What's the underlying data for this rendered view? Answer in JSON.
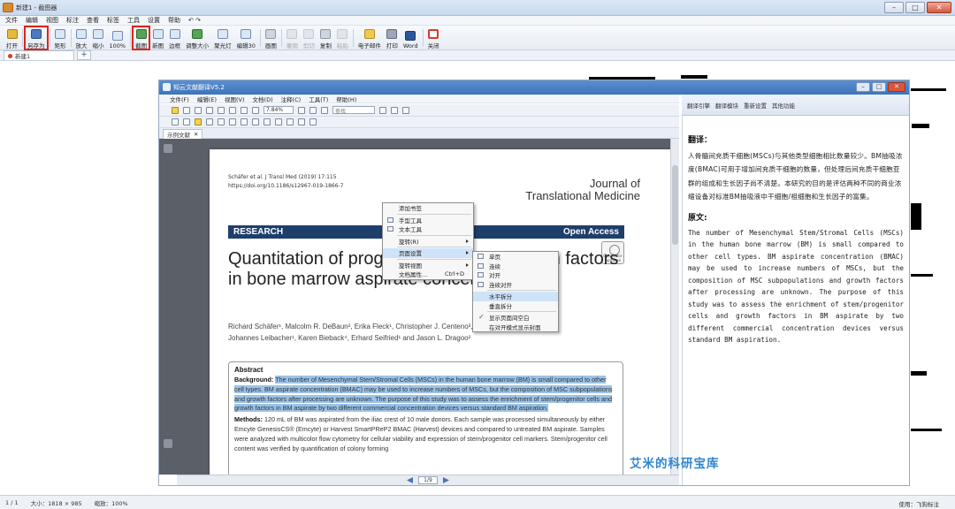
{
  "window": {
    "title": "新建1 - 截图器"
  },
  "menu": [
    "文件",
    "编辑",
    "视图",
    "标注",
    "查看",
    "标签",
    "工具",
    "设置",
    "帮助",
    "↶ ↷"
  ],
  "toolbar": [
    {
      "label": "打开",
      "icon": "open-folder-icon",
      "state": "normal"
    },
    {
      "label": "另存为",
      "icon": "save-as-icon",
      "state": "highlighted"
    },
    {
      "label": "矩形",
      "icon": "rect-select-icon",
      "state": "normal"
    },
    {
      "label": "放大",
      "icon": "zoom-in-icon",
      "state": "normal"
    },
    {
      "label": "缩小",
      "icon": "zoom-out-icon",
      "state": "normal"
    },
    {
      "label": "100%",
      "icon": "zoom-100-icon",
      "state": "normal"
    },
    {
      "label": "截图",
      "icon": "screenshot-icon",
      "state": "highlighted"
    },
    {
      "label": "新图",
      "icon": "new-image-icon",
      "state": "normal"
    },
    {
      "label": "边框",
      "icon": "border-icon",
      "state": "normal"
    },
    {
      "label": "调整大小",
      "icon": "resize-icon",
      "state": "normal"
    },
    {
      "label": "聚光灯",
      "icon": "spotlight-icon",
      "state": "normal"
    },
    {
      "label": "编辑30",
      "icon": "edit-icon",
      "state": "normal"
    },
    {
      "label": "画图",
      "icon": "paint-icon",
      "state": "normal"
    },
    {
      "label": "撤销",
      "icon": "undo-icon",
      "state": "disabled"
    },
    {
      "label": "剪切",
      "icon": "cut-icon",
      "state": "disabled"
    },
    {
      "label": "复制",
      "icon": "copy-icon",
      "state": "normal"
    },
    {
      "label": "粘贴",
      "icon": "paste-icon",
      "state": "disabled"
    },
    {
      "label": "电子邮件",
      "icon": "email-icon",
      "state": "normal"
    },
    {
      "label": "打印",
      "icon": "print-icon",
      "state": "normal"
    },
    {
      "label": "Word",
      "icon": "word-icon",
      "state": "normal"
    },
    {
      "label": "关闭",
      "icon": "close-circle-icon",
      "state": "normal"
    }
  ],
  "tabs": [
    {
      "label": "新建1"
    }
  ],
  "status": {
    "page": "1 / 1",
    "size": "大小：1818 × 985",
    "zoom": "缩放：100%",
    "right": "使用：飞狗标注"
  },
  "inner": {
    "title": "知云文献翻译V5.2",
    "menu": [
      "文件(F)",
      "编辑(E)",
      "视图(V)",
      "文档(D)",
      "注释(C)",
      "工具(T)",
      "帮助(H)"
    ],
    "zoom": "7.84%",
    "search_placeholder": "查找",
    "doc_tab": "示例文献",
    "page_nav": "1/9",
    "panel_tabs": [
      "翻译引擎",
      "翻译模块",
      "重新设置",
      "其他功能"
    ],
    "paper": {
      "citation": "Schäfer et al. J Transl Med        (2019) 17:115",
      "doi": "https://doi.org/10.1186/s12967-019-1866-7",
      "journal_line1": "Journal of",
      "journal_line2": "Translational Medicine",
      "section": "RESEARCH",
      "open_access": "Open Access",
      "check_updates": "Check for updates",
      "title": "Quantitation of progenitor cells and growth factors in bone marrow aspirate concentration",
      "authors_line1": "Richard Schäfer¹, Malcolm R. DeBaun², Erika Fleck¹, Christopher J. Centeno³, Daniel Kraft⁴,",
      "authors_line2": "Johannes Leibacher¹, Karen Bieback⁴, Erhard Seifried¹ and Jason L. Dragoo²",
      "abstract_heading": "Abstract",
      "background_label": "Background:",
      "background_text": "The number of Mesenchymal Stem/Stromal Cells (MSCs) in the human bone marrow (BM) is small compared to other cell types. BM aspirate concentration (BMAC) may be used to increase numbers of MSCs, but the composition of MSC subpopulations and growth factors after processing are unknown. The purpose of this study was to assess the enrichment of stem/progenitor cells and growth factors in BM aspirate by two different commercial concentration devices versus standard BM aspiration.",
      "methods_label": "Methods:",
      "methods_text": "120 mL of BM was aspirated from the iliac crest of 10 male donors. Each sample was processed simultaneously by either Emcyte GenesisCS® (Emcyte) or Harvest SmartPReP2 BMAC (Harvest) devices and compared to untreated BM aspirate. Samples were analyzed with multicolor flow cytometry for cellular viability and expression of stem/progenitor cell markers. Stem/progenitor cell content was verified by quantification of colony forming"
    },
    "context_menu": [
      {
        "label": "添加书签"
      },
      {
        "label": "手型工具"
      },
      {
        "label": "文本工具"
      },
      {
        "label": "旋转(R)",
        "submenu": true
      },
      {
        "label": "页面设置",
        "submenu": true,
        "selected": true
      },
      {
        "label": "旋转视图",
        "submenu": true
      },
      {
        "label": "文档属性...",
        "shortcut": "Ctrl+D"
      }
    ],
    "submenu": [
      {
        "label": "单页"
      },
      {
        "label": "连续"
      },
      {
        "label": "对开"
      },
      {
        "label": "连续对开"
      },
      {
        "label": "水平拆分",
        "selected": true
      },
      {
        "label": "垂直拆分"
      },
      {
        "label": "显示页面间空白",
        "checked": true
      },
      {
        "label": "在对开模式显示封面"
      }
    ],
    "translation": {
      "heading": "翻译：",
      "text": "人骨髓间充质干细胞(MSCs)与其他类型细胞相比数量较少。BM抽吸浓度(BMAC)可用于增加间充质干细胞的数量，但处理后间充质干细胞亚群的组成和生长因子尚不清楚。本研究的目的是评估两种不同的商业浓缩设备对标准BM抽吸液中干细胞/祖细胞和生长因子的富集。",
      "original_heading": "原文:",
      "original": "The number of Mesenchymal Stem/Stromal Cells (MSCs) in the human bone marrow (BM) is small compared to other cell types. BM aspirate concentration (BMAC) may be used to increase numbers of MSCs, but the composition of MSC subpopulations and growth factors after processing are unknown. The purpose of this study was to assess the enrichment of stem/progenitor cells and growth factors in BM aspirate by two different commercial concentration devices versus standard BM aspiration."
    }
  },
  "watermark": "艾米的科研宝库",
  "colors": {
    "highlight": "#e0231d",
    "selection": "#9cc3e8",
    "banner": "#1f3f6b",
    "watermark": "#2f86cf",
    "inner_title": "#4a80c4"
  }
}
